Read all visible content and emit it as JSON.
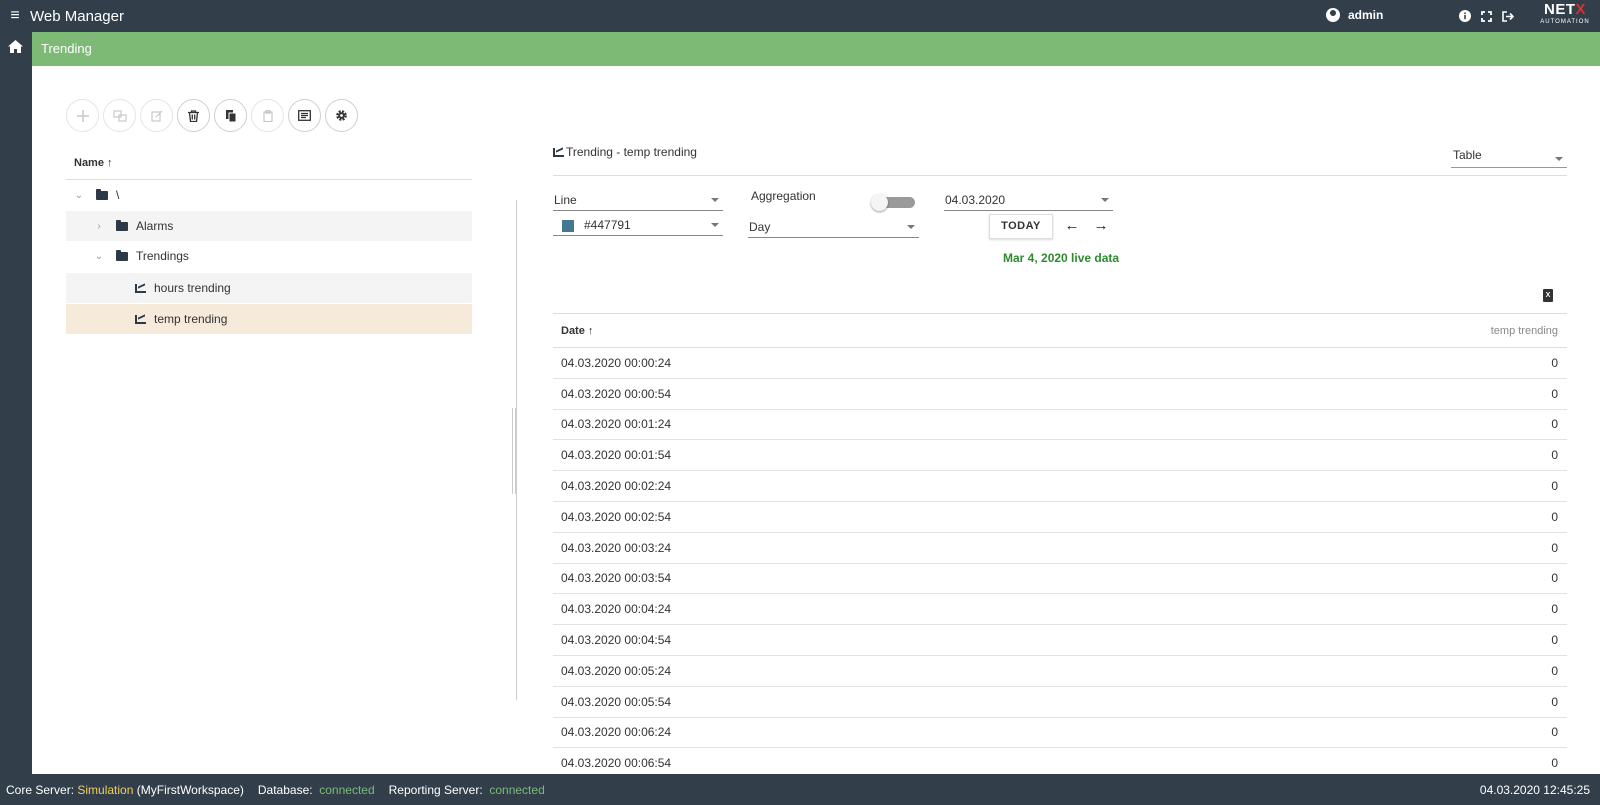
{
  "app": {
    "title": "Web Manager",
    "user": "admin",
    "logo_text": "NET",
    "logo_accent": "X",
    "logo_sub": "AUTOMATION"
  },
  "page": {
    "title": "Trending"
  },
  "tree": {
    "column_header": "Name ↑",
    "root": "\\",
    "items": [
      {
        "label": "Alarms"
      },
      {
        "label": "Trendings"
      },
      {
        "label": "hours trending"
      },
      {
        "label": "temp trending"
      }
    ]
  },
  "panel": {
    "title": "Trending - temp trending",
    "view_mode": "Table",
    "chart_type": "Line",
    "color_value": "#447791",
    "aggregation_label": "Aggregation",
    "aggregation_period": "Day",
    "date_value": "04.03.2020",
    "today_label": "TODAY",
    "prev_label": "←",
    "next_label": "→",
    "live_text": "Mar 4, 2020 live data"
  },
  "table": {
    "headers": {
      "date": "Date ↑",
      "value": "temp trending"
    },
    "rows": [
      {
        "date": "04.03.2020 00:00:24",
        "value": "0"
      },
      {
        "date": "04.03.2020 00:00:54",
        "value": "0"
      },
      {
        "date": "04.03.2020 00:01:24",
        "value": "0"
      },
      {
        "date": "04.03.2020 00:01:54",
        "value": "0"
      },
      {
        "date": "04.03.2020 00:02:24",
        "value": "0"
      },
      {
        "date": "04.03.2020 00:02:54",
        "value": "0"
      },
      {
        "date": "04.03.2020 00:03:24",
        "value": "0"
      },
      {
        "date": "04.03.2020 00:03:54",
        "value": "0"
      },
      {
        "date": "04.03.2020 00:04:24",
        "value": "0"
      },
      {
        "date": "04.03.2020 00:04:54",
        "value": "0"
      },
      {
        "date": "04.03.2020 00:05:24",
        "value": "0"
      },
      {
        "date": "04.03.2020 00:05:54",
        "value": "0"
      },
      {
        "date": "04.03.2020 00:06:24",
        "value": "0"
      },
      {
        "date": "04.03.2020 00:06:54",
        "value": "0"
      }
    ]
  },
  "status": {
    "core_label": "Core Server:",
    "core_mode": "Simulation",
    "core_workspace": "(MyFirstWorkspace)",
    "db_label": "Database:",
    "db_value": "connected",
    "reporting_label": "Reporting Server:",
    "reporting_value": "connected",
    "clock": "04.03.2020 12:45:25"
  },
  "colors": {
    "topbar": "#323f4b",
    "title_band": "#7cba76",
    "selected_row": "#f6eadb",
    "hover_row": "#f4f4f4",
    "live_text": "#2e8b2e",
    "status_yellow": "#f2cc5e",
    "status_green": "#7cba76"
  }
}
